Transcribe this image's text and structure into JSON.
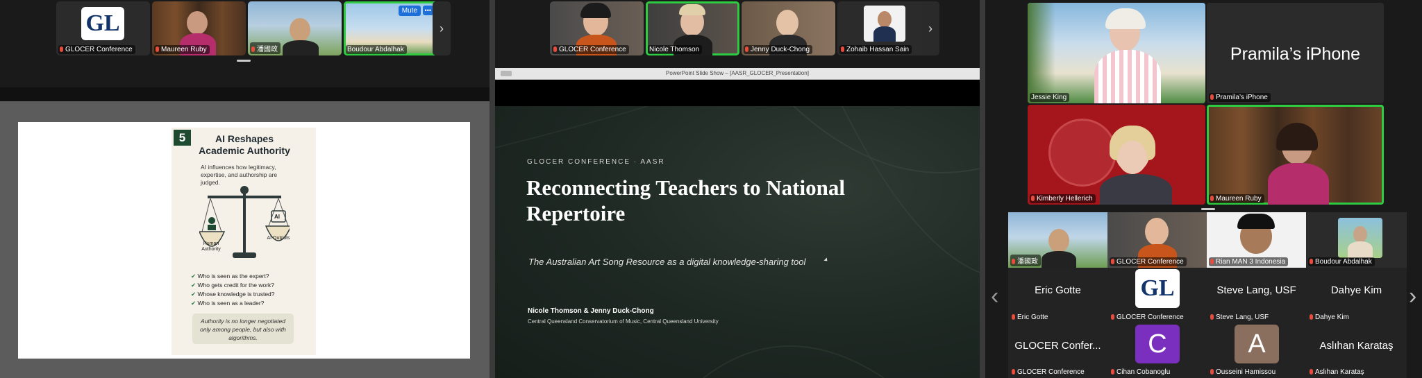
{
  "left": {
    "strip": [
      {
        "name": "GLOCER Conference"
      },
      {
        "name": "Maureen Ruby"
      },
      {
        "name": "潘國政"
      },
      {
        "name": "Boudour Abdalhak"
      }
    ],
    "gl_logo": "GL",
    "mute_label": "Mute",
    "more_label": "•••",
    "next_label": "›",
    "slide": {
      "number": "5",
      "title": "AI Reshapes Academic Authority",
      "subtitle": "AI influences how legitimacy, expertise, and authorship are judged.",
      "left_pan": "Human Authority",
      "right_pan": "AI Outputs",
      "chip": "AI",
      "checks": [
        "Who is seen as the expert?",
        "Who gets credit for the work?",
        "Whose knowledge is trusted?",
        "Who is seen as a leader?"
      ],
      "quote": "Authority is no longer negotiated only among people, but also with algorithms."
    }
  },
  "middle": {
    "strip": [
      {
        "name": "GLOCER Conference"
      },
      {
        "name": "Nicole Thomson"
      },
      {
        "name": "Jenny Duck-Chong"
      },
      {
        "name": "Zohaib Hassan Sain"
      }
    ],
    "next_label": "›",
    "window_title": "PowerPoint Slide Show – [AASR_GLOCER_Presentation]",
    "slide": {
      "kicker": "GLOCER CONFERENCE · AASR",
      "title": "Reconnecting Teachers to National Repertoire",
      "subtitle": "The Australian Art Song Resource as a digital knowledge-sharing tool",
      "authors": "Nicole Thomson & Jenny Duck-Chong",
      "affiliation": "Central Queensland Conservatorium of Music, Central Queensland University"
    }
  },
  "right": {
    "grid": [
      {
        "name": "Jessie King"
      },
      {
        "name": "Pramila's iPhone",
        "display": "Pramila’s iPhone"
      },
      {
        "name": "Kimberly Hellerich"
      },
      {
        "name": "Maureen Ruby"
      }
    ],
    "strip": [
      {
        "name": "潘國政"
      },
      {
        "name": "GLOCER Conference"
      },
      {
        "name": "Rian MAN 3 Indonesia"
      },
      {
        "name": "Boudour Abdalhak"
      }
    ],
    "row1": [
      {
        "display": "Eric Gotte",
        "name": "Eric Gotte"
      },
      {
        "display": "GL",
        "name": "GLOCER Conference"
      },
      {
        "display": "Steve Lang, USF",
        "name": "Steve Lang, USF"
      },
      {
        "display": "Dahye Kim",
        "name": "Dahye Kim"
      }
    ],
    "row2": [
      {
        "display": "GLOCER Confer...",
        "name": "GLOCER Conference"
      },
      {
        "display": "C",
        "name": "Cihan Cobanoglu"
      },
      {
        "display": "A",
        "name": "Ousseini Hamissou"
      },
      {
        "display": "Aslıhan Karataş",
        "name": "Aslıhan Karataş"
      }
    ],
    "prev_label": "‹",
    "next_label": "›",
    "colors": {
      "cihan": "#7b2fbe",
      "ousseini": "#8a6e5e"
    }
  }
}
